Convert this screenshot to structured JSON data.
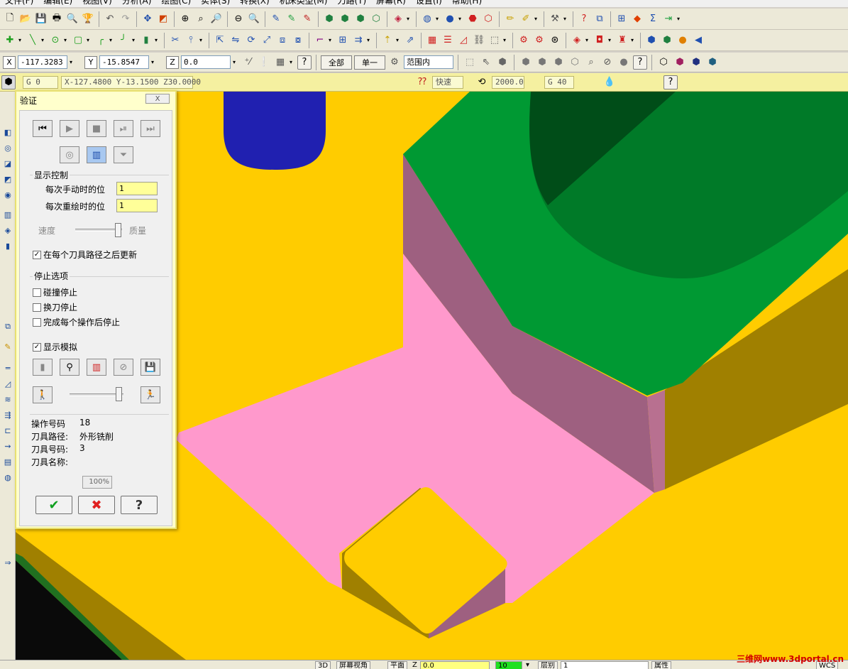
{
  "menu": [
    "文件(F)",
    "编辑(E)",
    "视图(V)",
    "分析(A)",
    "绘图(C)",
    "实体(S)",
    "转换(X)",
    "机床类型(M)",
    "刀路(T)",
    "屏幕(R)",
    "设置(I)",
    "帮助(H)"
  ],
  "coords": {
    "x_label": "X",
    "x_value": "-117.3283",
    "y_label": "Y",
    "y_value": "-15.8547",
    "z_label": "Z",
    "z_value": "0.0",
    "all_button": "全部",
    "single_button": "单一",
    "range_select": "范围内"
  },
  "status": {
    "g_code": "G 0",
    "position": "X-127.4800 Y-13.1500 Z30.0000",
    "speed_mode": "快速",
    "feed_value": "2000.0",
    "g_code2": "G 40"
  },
  "dialog": {
    "title": "验证",
    "close_label": "X",
    "display_control_title": "显示控制",
    "manual_step_label": "每次手动时的位",
    "manual_step_value": "1",
    "redraw_step_label": "每次重绘时的位",
    "redraw_step_value": "1",
    "speed_label": "速度",
    "quality_label": "质量",
    "update_after_path_label": "在每个刀具路径之后更新",
    "stop_options_title": "停止选项",
    "stop_on_collision_label": "碰撞停止",
    "stop_on_tool_change_label": "换刀停止",
    "stop_after_each_op_label": "完成每个操作后停止",
    "show_simulation_label": "显示模拟",
    "op_number_label": "操作号码",
    "op_number_value": "18",
    "toolpath_label": "刀具路径:",
    "toolpath_value": "外形铣削",
    "tool_number_label": "刀具号码:",
    "tool_number_value": "3",
    "tool_name_label": "刀具名称:",
    "tool_name_value": "",
    "progress_percent": "100%"
  },
  "bottom": {
    "mode_3d": "3D",
    "screen_view": "屏幕视角",
    "plane": "平面",
    "z_label": "Z",
    "z_value": "0.0",
    "level_value": "10",
    "layer_label": "层别",
    "layer_value": "1",
    "attributes": "属性",
    "wcs": "WCS"
  },
  "watermark": "三维网www.3dportal.cn",
  "colors": {
    "viewport_bg": "#ffcc00",
    "green_block": "#009933",
    "pink_floor": "#ff99cc",
    "mauve_wall": "#9e6080",
    "olive_wall": "#a08000",
    "blue_tool": "#2020b0",
    "dialog_bg": "#ffffcc"
  }
}
